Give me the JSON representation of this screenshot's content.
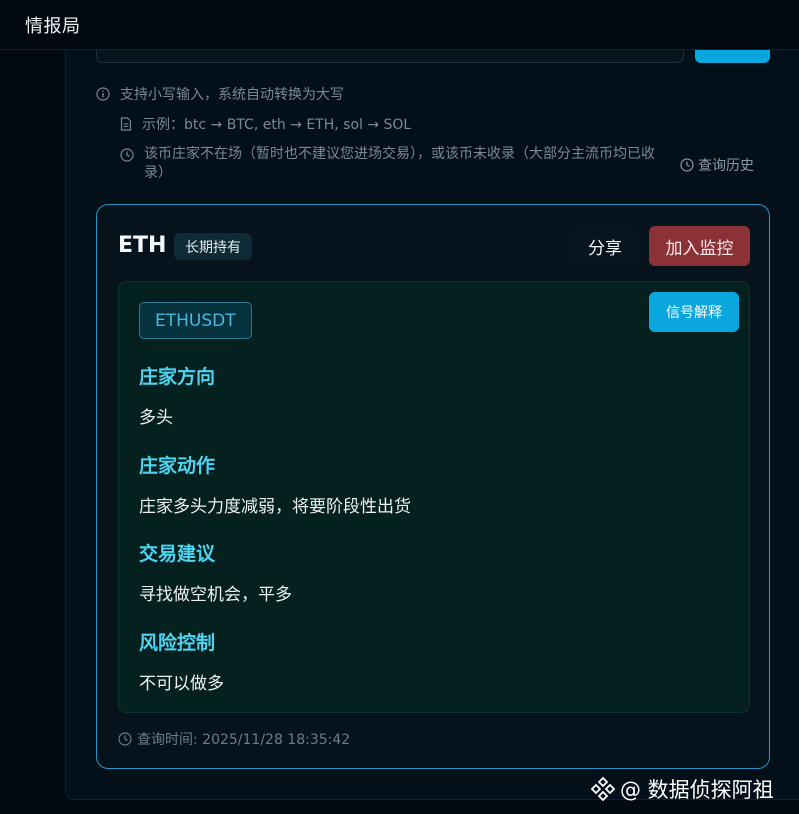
{
  "app": {
    "title": "情报局"
  },
  "hints": {
    "lowercase": "支持小写输入，系统自动转换为大写",
    "example": "示例：btc → BTC, eth → ETH, sol → SOL",
    "notice": "该币庄家不在场（暂时也不建议您进场交易），或该币未收录（大部分主流币均已收录）"
  },
  "history_link": "查询历史",
  "result": {
    "symbol": "ETH",
    "badge": "长期持有",
    "share_label": "分享",
    "monitor_label": "加入监控",
    "pair": "ETHUSDT",
    "explain_label": "信号解释",
    "sections": [
      {
        "title": "庄家方向",
        "value": "多头"
      },
      {
        "title": "庄家动作",
        "value": "庄家多头力度减弱，将要阶段性出货"
      },
      {
        "title": "交易建议",
        "value": "寻找做空机会，平多"
      },
      {
        "title": "风险控制",
        "value": "不可以做多"
      }
    ],
    "query_time": "查询时间: 2025/11/28 18:35:42"
  },
  "watermark": "@ 数据侦探阿祖",
  "colors": {
    "accent": "#0aa7df",
    "section_title": "#4ed4f0",
    "monitor": "#8b3236",
    "card_border": "#2a93c7"
  }
}
